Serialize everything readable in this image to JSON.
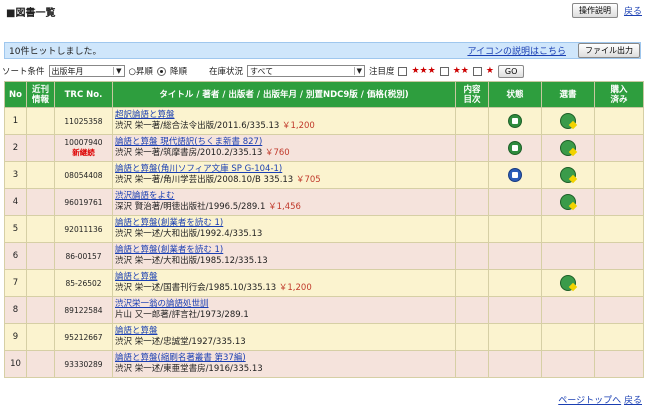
{
  "page_title": "■図書一覧",
  "top": {
    "manual_button": "操作説明",
    "back_link": "戻る"
  },
  "hitbar": {
    "hit_text": "10件ヒットしました。",
    "icon_help_link": "アイコンの説明はこちら",
    "file_output_button": "ファイル出力"
  },
  "sortbar": {
    "sort_label": "ソート条件",
    "sort_value": "出版年月",
    "asc_label": "○昇順",
    "desc_label": "降順",
    "stock_label": "在庫状況",
    "stock_value": "すべて",
    "attention_label": "注目度",
    "stars3": "★★★",
    "stars2": "★★",
    "stars1": "★",
    "go_button": "GO"
  },
  "table": {
    "headers": {
      "no": "No",
      "recent": "近刊\n情報",
      "trc": "TRC No.",
      "title": "タイトル / 著者 / 出版者 / 出版年月 / 別置NDC9版 / 価格(税別)",
      "toc": "内容\n目次",
      "status": "状態",
      "select": "選書",
      "purchased": "購入\n済み"
    },
    "rows": [
      {
        "no": "1",
        "trc": "11025358",
        "new": "",
        "title": "超訳論語と算盤",
        "detail": "渋沢 栄一著/総合法令出版/2011.6/335.13",
        "price": "￥1,200",
        "status": "green",
        "select": true
      },
      {
        "no": "2",
        "trc": "10007940",
        "new": "新継続",
        "title": "論語と算盤 現代語訳(ちくま新書 827)",
        "detail": "渋沢 栄一著/筑摩書房/2010.2/335.13",
        "price": "￥760",
        "status": "green",
        "select": true
      },
      {
        "no": "3",
        "trc": "08054408",
        "new": "",
        "title": "論語と算盤(角川ソフィア文庫 SP G-104-1)",
        "detail": "渋沢 栄一著/角川学芸出版/2008.10/B 335.13",
        "price": "￥705",
        "status": "blue",
        "select": true
      },
      {
        "no": "4",
        "trc": "96019761",
        "new": "",
        "title": "渋沢論語をよむ",
        "detail": "深沢 賢治著/明徳出版社/1996.5/289.1",
        "price": "￥1,456",
        "status": "",
        "select": true
      },
      {
        "no": "5",
        "trc": "92011136",
        "new": "",
        "title": "論語と算盤(創業者を読む 1)",
        "detail": "渋沢 栄一述/大和出版/1992.4/335.13",
        "price": "",
        "status": "",
        "select": false
      },
      {
        "no": "6",
        "trc": "86-00157",
        "new": "",
        "title": "論語と算盤(創業者を読む 1)",
        "detail": "渋沢 栄一述/大和出版/1985.12/335.13",
        "price": "",
        "status": "",
        "select": false
      },
      {
        "no": "7",
        "trc": "85-26502",
        "new": "",
        "title": "論語と算盤",
        "detail": "渋沢 栄一述/国書刊行会/1985.10/335.13",
        "price": "￥1,200",
        "status": "",
        "select": true
      },
      {
        "no": "8",
        "trc": "89122584",
        "new": "",
        "title": "渋沢栄一翁の論語処世訓",
        "detail": "片山 又一郎著/評言社/1973/289.1",
        "price": "",
        "status": "",
        "select": false
      },
      {
        "no": "9",
        "trc": "95212667",
        "new": "",
        "title": "論語と算盤",
        "detail": "渋沢 栄一述/忠誠堂/1927/335.13",
        "price": "",
        "status": "",
        "select": false
      },
      {
        "no": "10",
        "trc": "93330289",
        "new": "",
        "title": "論語と算盤(縮刷名著叢書 第37編)",
        "detail": "渋沢 栄一述/東亜堂書房/1916/335.13",
        "price": "",
        "status": "",
        "select": false
      }
    ]
  },
  "bottom": {
    "page_top_link": "ページトップへ",
    "back_link": "戻る"
  }
}
